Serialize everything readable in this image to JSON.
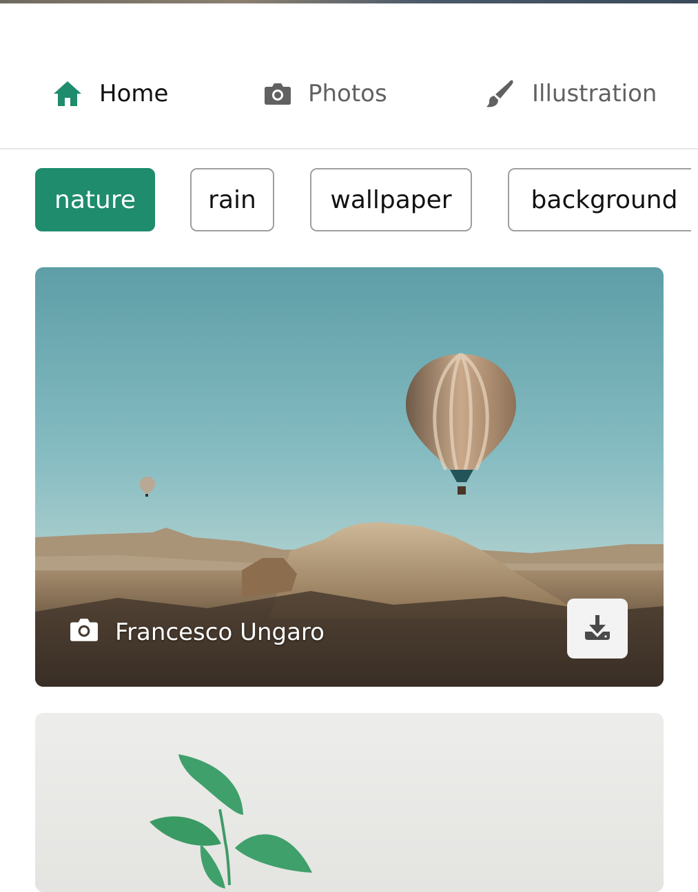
{
  "nav": {
    "items": [
      {
        "label": "Home",
        "icon": "home-icon",
        "active": true
      },
      {
        "label": "Photos",
        "icon": "camera-icon",
        "active": false
      },
      {
        "label": "Illustration",
        "icon": "brush-icon",
        "active": false
      }
    ]
  },
  "tags": [
    {
      "label": "nature",
      "active": true
    },
    {
      "label": "rain",
      "active": false
    },
    {
      "label": "wallpaper",
      "active": false
    },
    {
      "label": "background",
      "active": false
    }
  ],
  "photos": [
    {
      "author": "Francesco Ungaro",
      "author_icon": "camera-icon",
      "action_icon": "download-icon"
    },
    {
      "author": "",
      "author_icon": "",
      "action_icon": ""
    }
  ],
  "colors": {
    "accent": "#1e8c6d",
    "nav_active_text": "#111111",
    "nav_inactive_text": "#616161"
  }
}
